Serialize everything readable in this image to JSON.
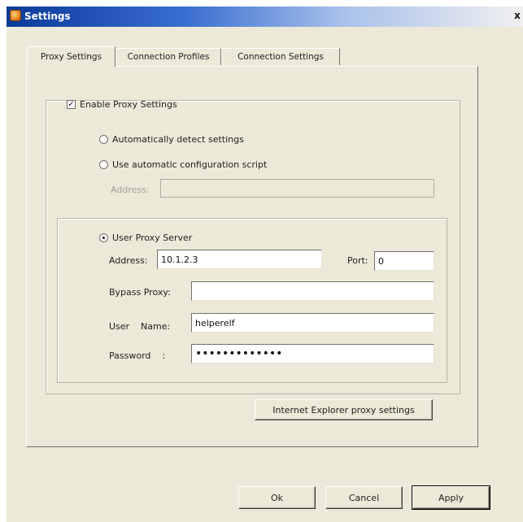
{
  "window": {
    "title": "Settings",
    "close_glyph": "x"
  },
  "tabs": [
    {
      "label": "Proxy Settings",
      "active": true
    },
    {
      "label": "Connection Profiles",
      "active": false
    },
    {
      "label": "Connection Settings",
      "active": false
    }
  ],
  "proxy": {
    "enable_label": "Enable Proxy Settings",
    "enable_checked": true,
    "auto_detect_label": "Automatically detect settings",
    "auto_script_label": "Use automatic configuration script",
    "script_address_label": "Address:",
    "script_address_value": "",
    "user_proxy_label": "User Proxy Server",
    "user_proxy_selected": true,
    "address_label": "Address:",
    "address_value": "10.1.2.3",
    "port_label": "Port:",
    "port_value": "0",
    "bypass_label": "Bypass Proxy:",
    "bypass_value": "",
    "username_label": "User    Name:",
    "username_value": "helperelf",
    "password_label": "Password    :",
    "password_value": "•••••••••••••",
    "ie_button_label": "Internet Explorer proxy settings"
  },
  "buttons": {
    "ok": "Ok",
    "cancel": "Cancel",
    "apply": "Apply"
  },
  "icons": {
    "app": "settings-app-icon",
    "close": "close-icon"
  }
}
